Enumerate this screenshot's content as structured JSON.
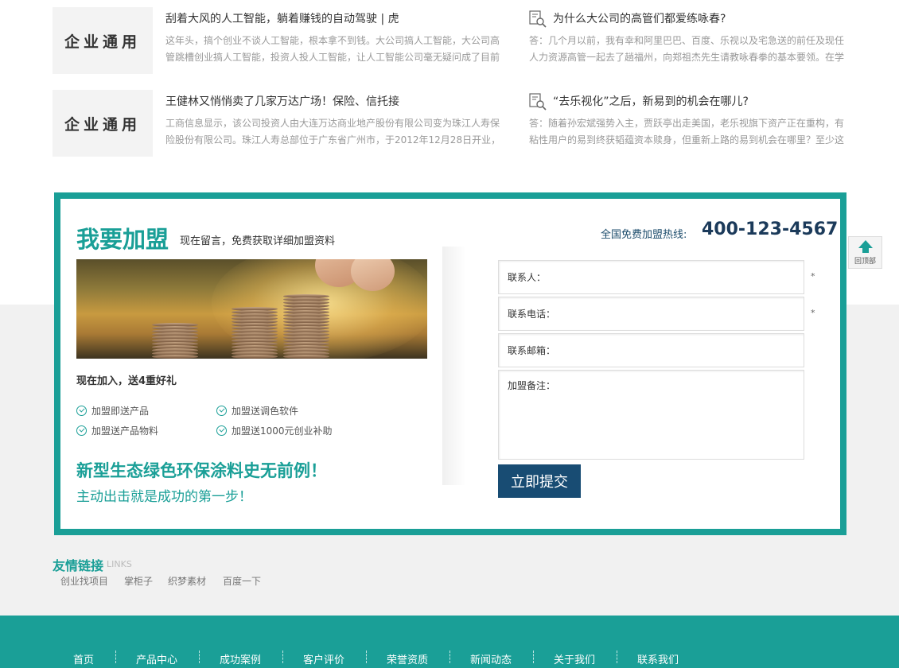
{
  "news": [
    {
      "thumb_text": "企业通用",
      "title": "刮着大风的人工智能，躺着赚钱的自动驾驶 | 虎",
      "desc": "这年头，搞个创业不谈人工智能，根本拿不到钱。大公司搞人工智能，大公司高管跳槽创业搞人工智能，投资人投人工智能，让人工智能公司毫无疑问成了目前"
    },
    {
      "thumb_text": "企业通用",
      "title": "王健林又悄悄卖了几家万达广场！保险、信托接",
      "desc": "工商信息显示，该公司投资人由大连万达商业地产股份有限公司变为珠江人寿保险股份有限公司。珠江人寿总部位于广东省广州市，于2012年12月28日开业，"
    }
  ],
  "qa": [
    {
      "icon": "search-doc-icon",
      "title": "为什么大公司的高管们都爱练咏春?",
      "desc": "答：几个月以前，我有幸和阿里巴巴、百度、乐视以及宅急送的前任及现任人力资源高管一起去了趟福州，向郑祖杰先生请教咏春拳的基本要领。在学"
    },
    {
      "icon": "search-doc-icon",
      "title": "“去乐视化”之后，新易到的机会在哪儿?",
      "desc": "答：随着孙宏斌强势入主，贾跃亭出走美国，老乐视旗下资产正在重构，有粘性用户的易到终获韬蕴资本赎身，但重新上路的易到机会在哪里？至少这"
    }
  ],
  "join": {
    "title": "我要加盟",
    "subtitle": "现在留言，免费获取详细加盟资料",
    "hotline_label": "全国免费加盟热线:",
    "hotline": "400-123-4567",
    "gift_title": "现在加入，送4重好礼",
    "benefits": [
      "加盟即送产品",
      "加盟送调色软件",
      "加盟送产品物料",
      "加盟送1000元创业补助"
    ],
    "slogan1": "新型生态绿色环保涂料史无前例！",
    "slogan2": "主动出击就是成功的第一步！",
    "form": {
      "contact_label": "联系人：",
      "phone_label": "联系电话：",
      "email_label": "联系邮箱：",
      "note_label": "加盟备注：",
      "required_mark": "*",
      "submit": "立即提交"
    }
  },
  "back_to_top": "回顶部",
  "links": {
    "title": "友情链接",
    "title_en": "LINKS",
    "items": [
      "创业找项目",
      "掌柜子",
      "织梦素材",
      "百度一下"
    ]
  },
  "footer_nav": [
    "首页",
    "产品中心",
    "成功案例",
    "客户评价",
    "荣誉资质",
    "新闻动态",
    "关于我们",
    "联系我们"
  ],
  "colors": {
    "accent": "#1a9f97",
    "submit_bg": "#184c73",
    "hotline": "#1b3a5a"
  }
}
